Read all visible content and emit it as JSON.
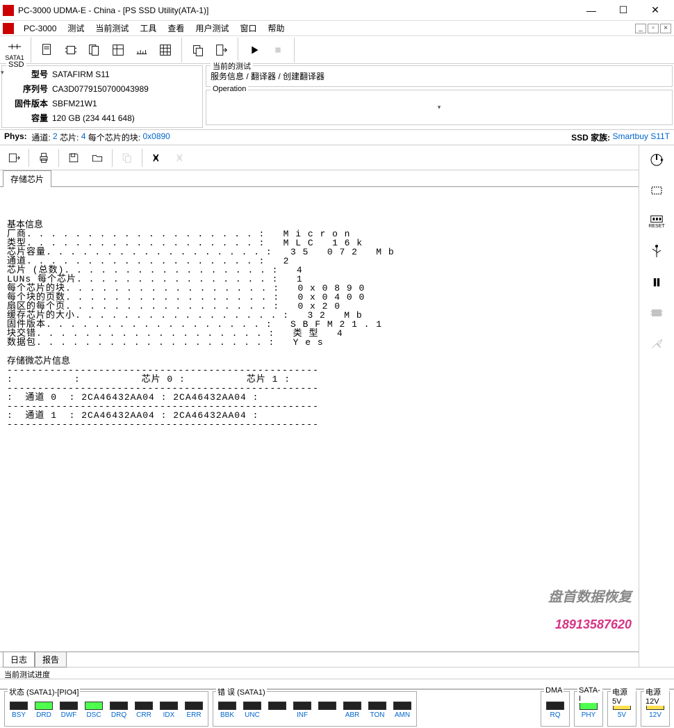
{
  "window": {
    "title": "PC-3000 UDMA-E - China - [PS SSD Utility(ATA-1)]"
  },
  "menu": {
    "items": [
      "PC-3000",
      "测试",
      "当前测试",
      "工具",
      "查看",
      "用户测试",
      "窗口",
      "帮助"
    ]
  },
  "toolbar": {
    "sata_label": "SATA1"
  },
  "ssd_info": {
    "box_title": "SSD",
    "model_label": "型号",
    "model_value": "SATAFIRM   S11",
    "serial_label": "序列号",
    "serial_value": "CA3D0779150700043989",
    "firmware_label": "固件版本",
    "firmware_value": "SBFM21W1",
    "capacity_label": "容量",
    "capacity_value": "120 GB (234 441 648)"
  },
  "current_test": {
    "box_title": "当前的测试",
    "breadcrumb": "服务信息 / 翻译器 / 创建翻译器"
  },
  "operation": {
    "box_title": "Operation",
    "arrow": "▾"
  },
  "phys": {
    "label": "Phys:",
    "channel_label": "通道:",
    "channel_value": "2",
    "chip_label": "芯片:",
    "chip_value": "4",
    "blocks_label": "每个芯片的块:",
    "blocks_value": "0x0890",
    "family_label": "SSD 家族:",
    "family_value": "Smartbuy S11T"
  },
  "tabs": {
    "storage_chip": "存储芯片"
  },
  "content": {
    "basic_title": "基本信息",
    "rows": [
      {
        "k": "厂商",
        "v": "Micron"
      },
      {
        "k": "类型",
        "v": "MLC 16k"
      },
      {
        "k": "芯片容量",
        "v": "35 072 Mb"
      },
      {
        "k": "通道",
        "v": "2"
      },
      {
        "k": "芯片 (总数)",
        "v": "4"
      },
      {
        "k": "LUNs 每个芯片",
        "v": "1"
      },
      {
        "k": "每个芯片的块",
        "v": "0x0890"
      },
      {
        "k": "每个块的页数",
        "v": "0x0400"
      },
      {
        "k": "扇区的每个页",
        "v": "0x20"
      },
      {
        "k": "缓存芯片的大小",
        "v": "32 Mb"
      },
      {
        "k": "固件版本",
        "v": "SBFM21.1"
      },
      {
        "k": "块交错",
        "v": "类型 4"
      },
      {
        "k": "数据包",
        "v": "Yes"
      }
    ],
    "table_title": "存储微芯片信息",
    "table_header": ":          :          芯片 0 :          芯片 1 :",
    "table_rows": [
      ":  通道 0  : 2CA46432AA04 : 2CA46432AA04 :",
      ":  通道 1  : 2CA46432AA04 : 2CA46432AA04 :"
    ],
    "watermark1": "盘首数据恢复",
    "watermark2": "18913587620"
  },
  "bottom_tabs": {
    "log": "日志",
    "report": "报告"
  },
  "progress": {
    "label": "当前测试进度"
  },
  "status": {
    "group1_title": "状态 (SATA1)-[PIO4]",
    "group1": [
      {
        "label": "BSY",
        "on": false
      },
      {
        "label": "DRD",
        "on": true
      },
      {
        "label": "DWF",
        "on": false
      },
      {
        "label": "DSC",
        "on": true
      },
      {
        "label": "DRQ",
        "on": false
      },
      {
        "label": "CRR",
        "on": false
      },
      {
        "label": "IDX",
        "on": false
      },
      {
        "label": "ERR",
        "on": false
      }
    ],
    "group2_title": "错 误 (SATA1)",
    "group2": [
      {
        "label": "BBK",
        "on": false
      },
      {
        "label": "UNC",
        "on": false
      },
      {
        "label": "",
        "on": false
      },
      {
        "label": "INF",
        "on": false
      },
      {
        "label": "",
        "on": false
      },
      {
        "label": "ABR",
        "on": false
      },
      {
        "label": "TON",
        "on": false
      },
      {
        "label": "AMN",
        "on": false
      }
    ],
    "group3_title": "DMA",
    "group3": [
      {
        "label": "RQ",
        "on": false
      }
    ],
    "group4_title": "SATA-I",
    "group4": [
      {
        "label": "PHY",
        "on": true
      }
    ],
    "group5_title": "电源 5V",
    "group5": [
      {
        "label": "5V",
        "on": true,
        "yellow": true
      }
    ],
    "group6_title": "电源 12V",
    "group6": [
      {
        "label": "12V",
        "on": true,
        "yellow": true
      }
    ]
  }
}
